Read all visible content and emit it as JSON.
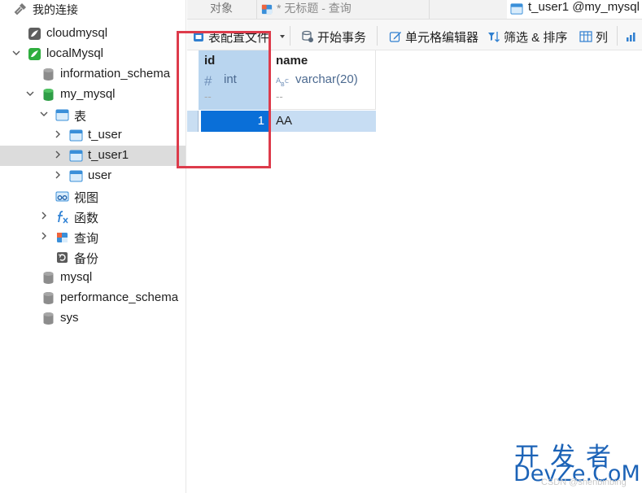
{
  "sidebar": {
    "header_label": "我的连接",
    "items": [
      {
        "label": "cloudmysql",
        "icon": "connection-icon"
      },
      {
        "label": "localMysql",
        "icon": "connection-active-icon"
      },
      {
        "label": "information_schema",
        "icon": "database-icon"
      },
      {
        "label": "my_mysql",
        "icon": "database-open-icon"
      },
      {
        "label": "表",
        "icon": "tables-folder-icon"
      },
      {
        "label": "t_user",
        "icon": "table-icon"
      },
      {
        "label": "t_user1",
        "icon": "table-icon"
      },
      {
        "label": "user",
        "icon": "table-icon"
      },
      {
        "label": "视图",
        "icon": "views-icon"
      },
      {
        "label": "函数",
        "icon": "function-icon"
      },
      {
        "label": "查询",
        "icon": "query-icon"
      },
      {
        "label": "备份",
        "icon": "backup-icon"
      },
      {
        "label": "mysql",
        "icon": "database-icon"
      },
      {
        "label": "performance_schema",
        "icon": "database-icon"
      },
      {
        "label": "sys",
        "icon": "database-icon"
      }
    ]
  },
  "tabs": [
    {
      "label": "对象"
    },
    {
      "label": "* 无标题 - 查询"
    },
    {
      "label": "t_user1 @my_mysql"
    }
  ],
  "toolbar": {
    "profile_label": "表配置文件",
    "begin_txn_label": "开始事务",
    "cell_editor_label": "单元格编辑器",
    "filter_sort_label": "筛选 & 排序",
    "columns_label": "列"
  },
  "grid": {
    "columns": [
      {
        "name": "id",
        "type": "int",
        "comment": "--"
      },
      {
        "name": "name",
        "type": "varchar(20)",
        "comment": "--"
      }
    ],
    "rows": [
      [
        "1",
        "AA"
      ]
    ]
  },
  "watermark": {
    "cn": "开发者",
    "en": "DevZe.CoM",
    "small": "CSDN @shenbinbing"
  },
  "colors": {
    "selection_blue": "#0a6fd8",
    "header_selected": "#b9d5ef",
    "annotation_red": "#dd3b4b",
    "watermark_blue": "#1c63b7"
  }
}
